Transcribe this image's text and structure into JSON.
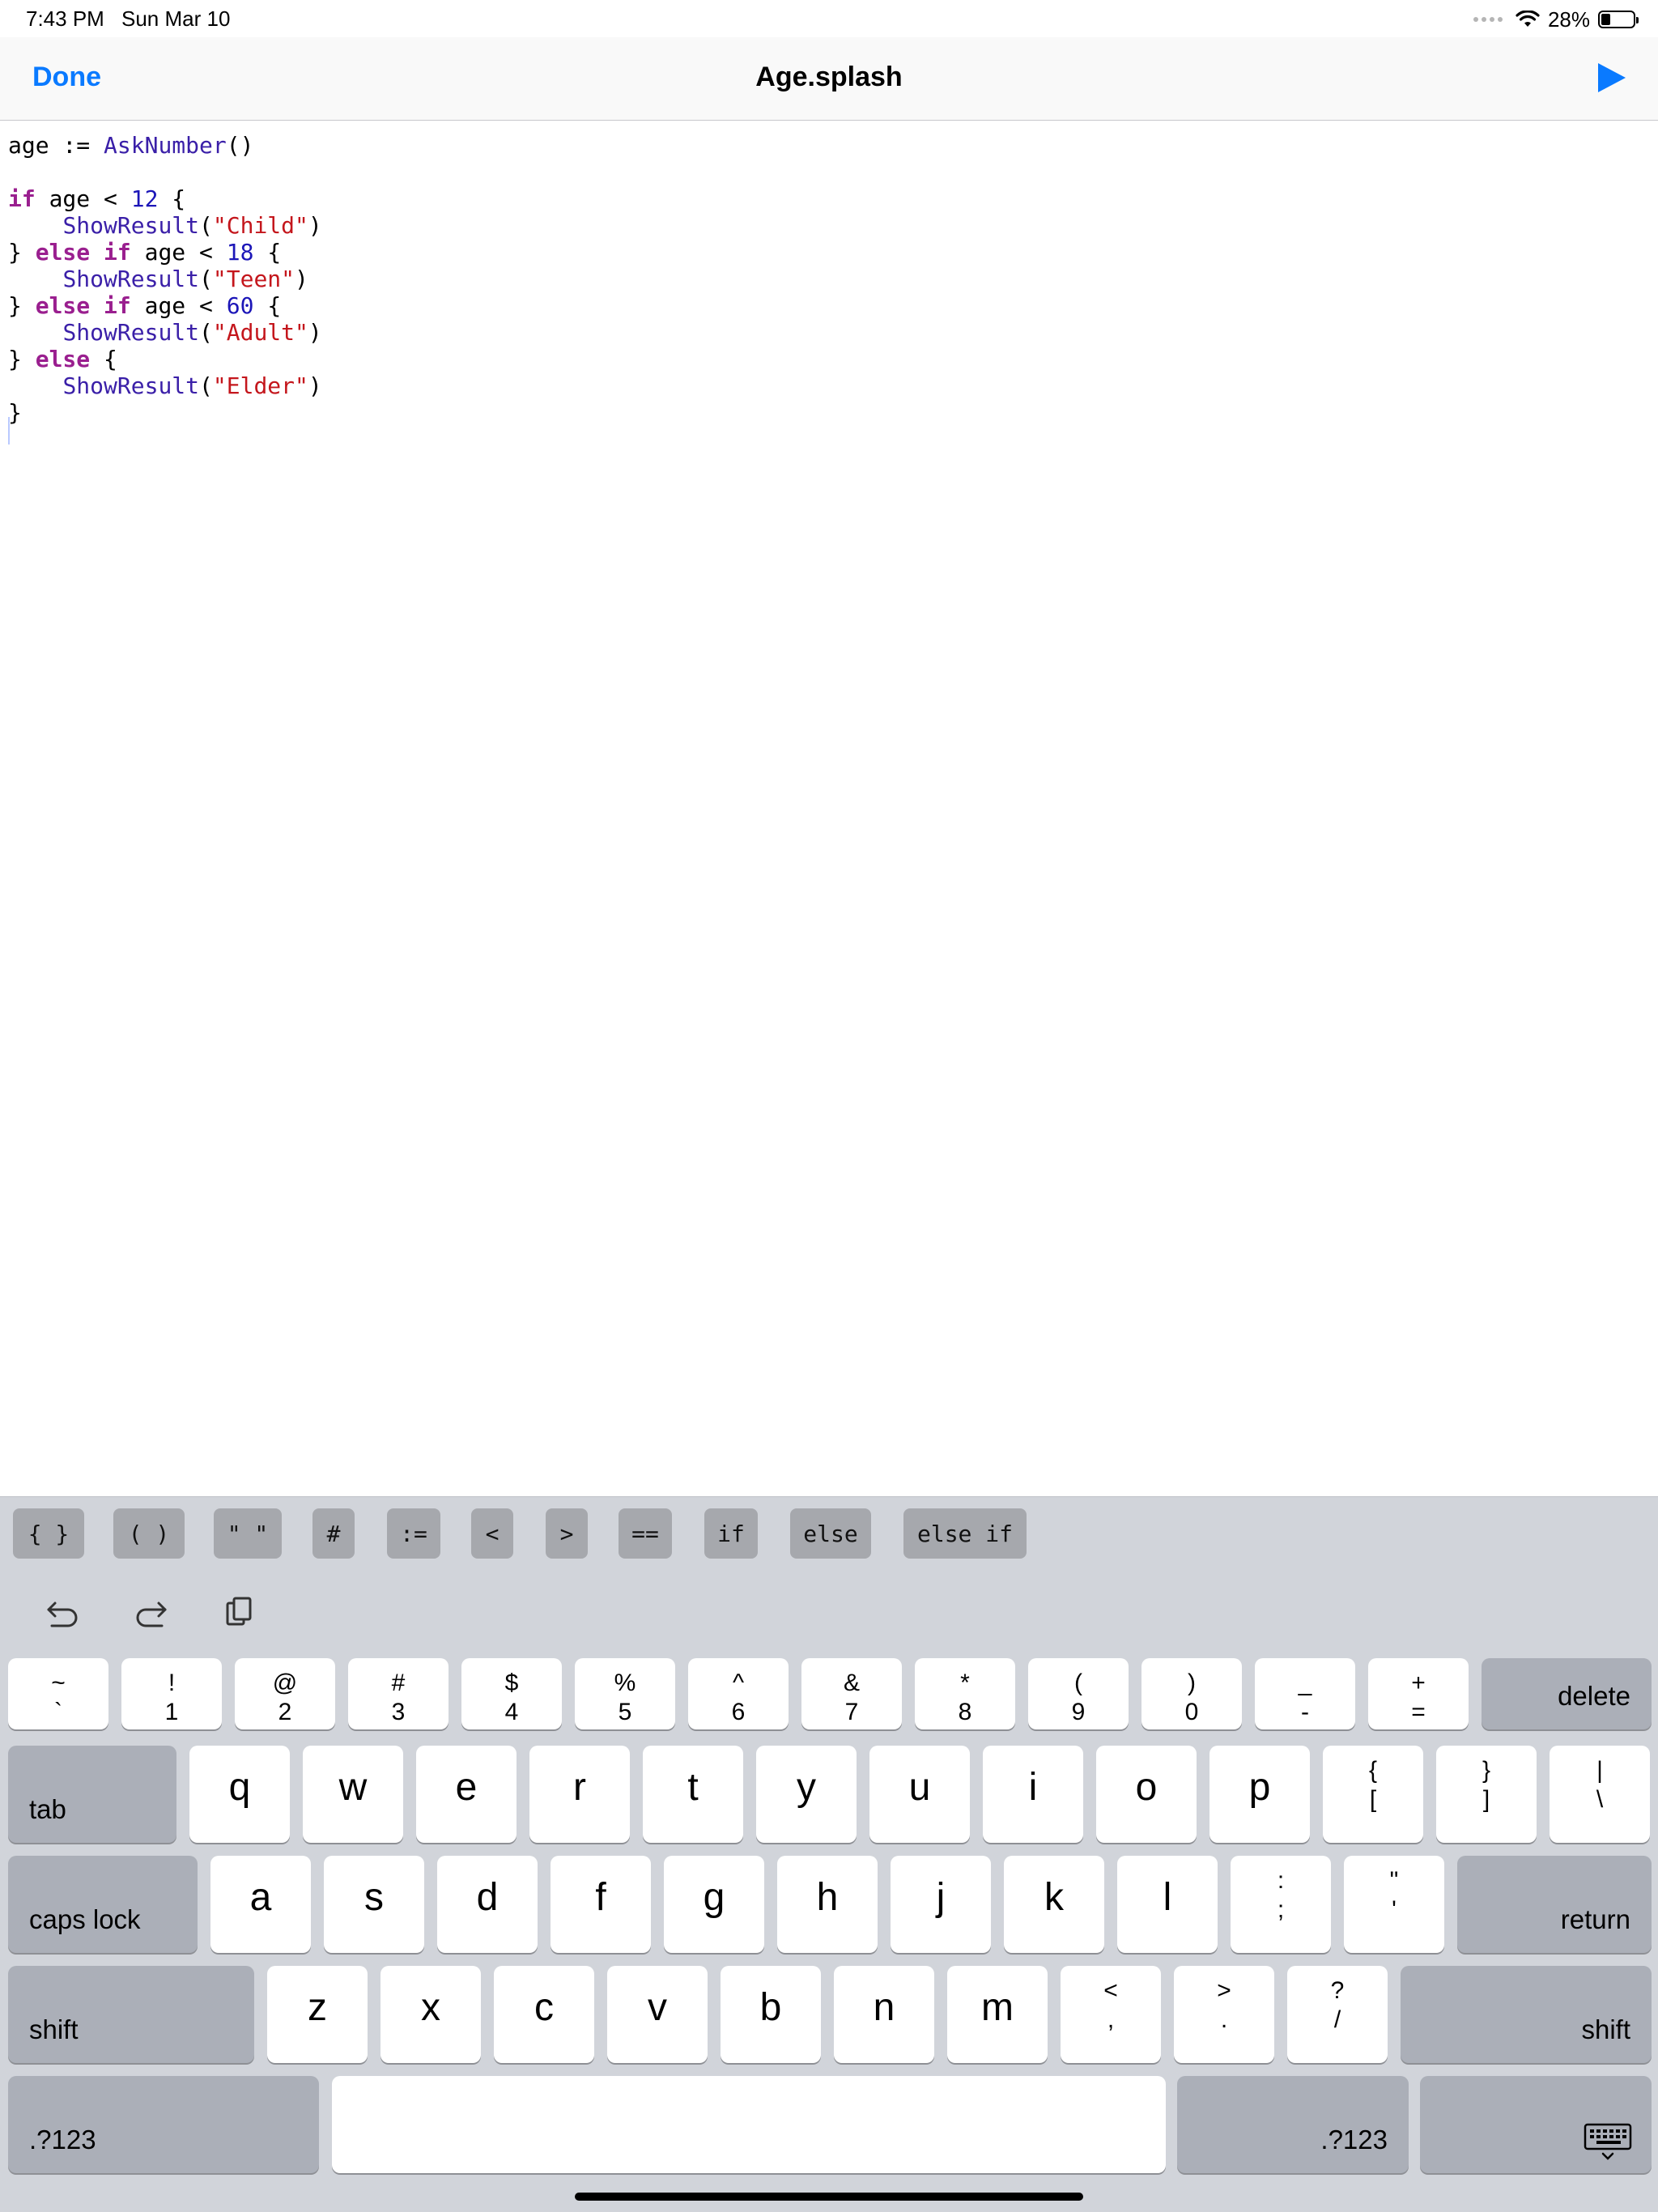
{
  "status": {
    "time": "7:43 PM",
    "date": "Sun Mar 10",
    "battery": "28%",
    "battery_level": 0.28
  },
  "nav": {
    "done": "Done",
    "title": "Age.splash"
  },
  "code": {
    "l1": {
      "ident": "age",
      "op": " := ",
      "fn": "AskNumber",
      "rest": "()"
    },
    "l3": {
      "kw": "if",
      "mid": " age < ",
      "num": "12",
      "end": " {"
    },
    "l4": {
      "indent": "    ",
      "fn": "ShowResult",
      "open": "(",
      "str": "\"Child\"",
      "close": ")"
    },
    "l5": {
      "brace": "} ",
      "kw_else": "else",
      "sp": " ",
      "kw_if": "if",
      "mid": " age < ",
      "num": "18",
      "end": " {"
    },
    "l6": {
      "indent": "    ",
      "fn": "ShowResult",
      "open": "(",
      "str": "\"Teen\"",
      "close": ")"
    },
    "l7": {
      "brace": "} ",
      "kw_else": "else",
      "sp": " ",
      "kw_if": "if",
      "mid": " age < ",
      "num": "60",
      "end": " {"
    },
    "l8": {
      "indent": "    ",
      "fn": "ShowResult",
      "open": "(",
      "str": "\"Adult\"",
      "close": ")"
    },
    "l9": {
      "brace": "} ",
      "kw_else": "else",
      "end": " {"
    },
    "l10": {
      "indent": "    ",
      "fn": "ShowResult",
      "open": "(",
      "str": "\"Elder\"",
      "close": ")"
    },
    "l11": {
      "brace": "}"
    }
  },
  "snippets": [
    "{ }",
    "( )",
    "\" \"",
    "#",
    ":=",
    "<",
    ">",
    "==",
    "if",
    "else",
    "else if"
  ],
  "keyboard": {
    "shortcuts": [
      "undo-icon",
      "redo-icon",
      "paste-icon"
    ],
    "row1": [
      {
        "top": "~",
        "bottom": "`"
      },
      {
        "top": "!",
        "bottom": "1"
      },
      {
        "top": "@",
        "bottom": "2"
      },
      {
        "top": "#",
        "bottom": "3"
      },
      {
        "top": "$",
        "bottom": "4"
      },
      {
        "top": "%",
        "bottom": "5"
      },
      {
        "top": "^",
        "bottom": "6"
      },
      {
        "top": "&",
        "bottom": "7"
      },
      {
        "top": "*",
        "bottom": "8"
      },
      {
        "top": "(",
        "bottom": "9"
      },
      {
        "top": ")",
        "bottom": "0"
      },
      {
        "top": "_",
        "bottom": "-"
      },
      {
        "top": "+",
        "bottom": "="
      }
    ],
    "delete": "delete",
    "tab": "tab",
    "row2": [
      "q",
      "w",
      "e",
      "r",
      "t",
      "y",
      "u",
      "i",
      "o",
      "p"
    ],
    "row2_sym": [
      {
        "top": "{",
        "bottom": "["
      },
      {
        "top": "}",
        "bottom": "]"
      },
      {
        "top": "|",
        "bottom": "\\"
      }
    ],
    "caps_lock": "caps lock",
    "row3": [
      "a",
      "s",
      "d",
      "f",
      "g",
      "h",
      "j",
      "k",
      "l"
    ],
    "row3_sym": [
      {
        "top": ":",
        "bottom": ";"
      },
      {
        "top": "\"",
        "bottom": "'"
      }
    ],
    "return": "return",
    "shift": "shift",
    "row4": [
      "z",
      "x",
      "c",
      "v",
      "b",
      "n",
      "m"
    ],
    "row4_sym": [
      {
        "top": "<",
        "bottom": ","
      },
      {
        "top": ">",
        "bottom": "."
      },
      {
        "top": "?",
        "bottom": "/"
      }
    ],
    "numbers": ".?123",
    "hide_keyboard_icon": "keyboard-dismiss-icon"
  },
  "colors": {
    "accent": "#0a7aff",
    "keyword": "#9a1f8f",
    "function": "#3a1fa8",
    "number": "#1c16b8",
    "string": "#c4161c"
  }
}
